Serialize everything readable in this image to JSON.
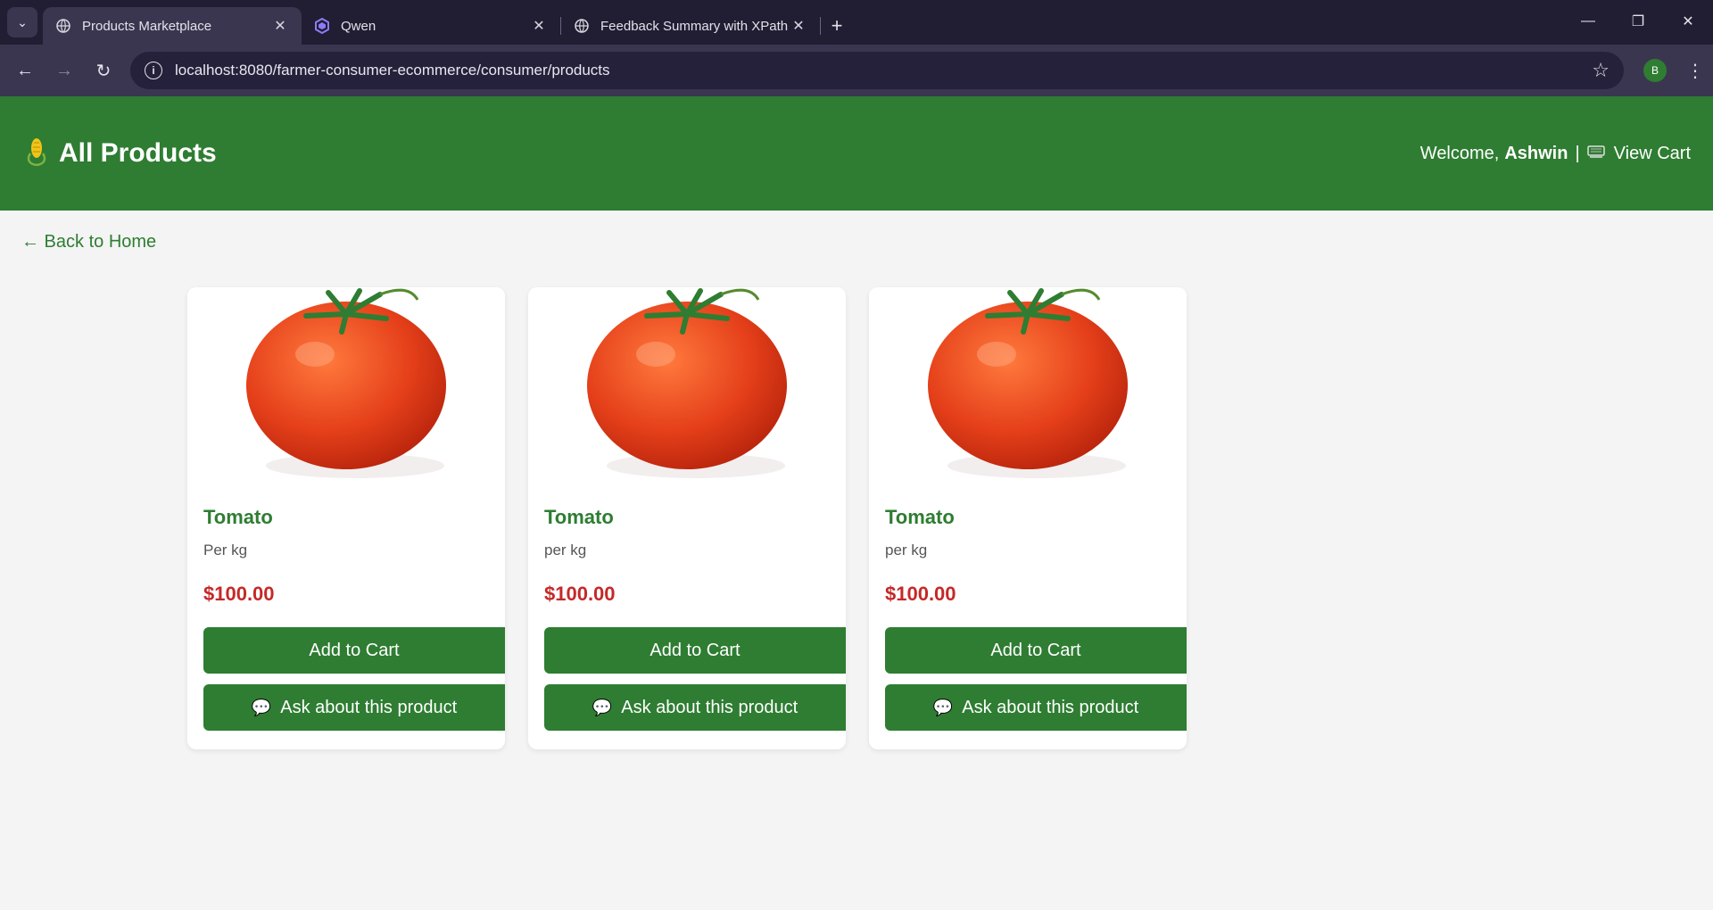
{
  "browser": {
    "tabs": [
      {
        "title": "Products Marketplace",
        "active": true
      },
      {
        "title": "Qwen",
        "active": false
      },
      {
        "title": "Feedback Summary with XPath",
        "active": false
      }
    ],
    "url": "localhost:8080/farmer-consumer-ecommerce/consumer/products",
    "profile_initial": "B"
  },
  "header": {
    "title": "All Products",
    "welcome_label": "Welcome,",
    "username": "Ashwin",
    "separator": "|",
    "view_cart_label": "View Cart",
    "brand_icon": "corn-icon",
    "cart_icon": "cart-icon"
  },
  "back_link": "← Back to Home",
  "products": [
    {
      "name": "Tomato",
      "unit": "Per kg",
      "price": "$100.00",
      "add_label": "Add to Cart",
      "ask_label": "Ask about this product"
    },
    {
      "name": "Tomato",
      "unit": "per kg",
      "price": "$100.00",
      "add_label": "Add to Cart",
      "ask_label": "Ask about this product"
    },
    {
      "name": "Tomato",
      "unit": "per kg",
      "price": "$100.00",
      "add_label": "Add to Cart",
      "ask_label": "Ask about this product"
    }
  ],
  "colors": {
    "brand_green": "#2e7d32",
    "price_red": "#c62828"
  }
}
